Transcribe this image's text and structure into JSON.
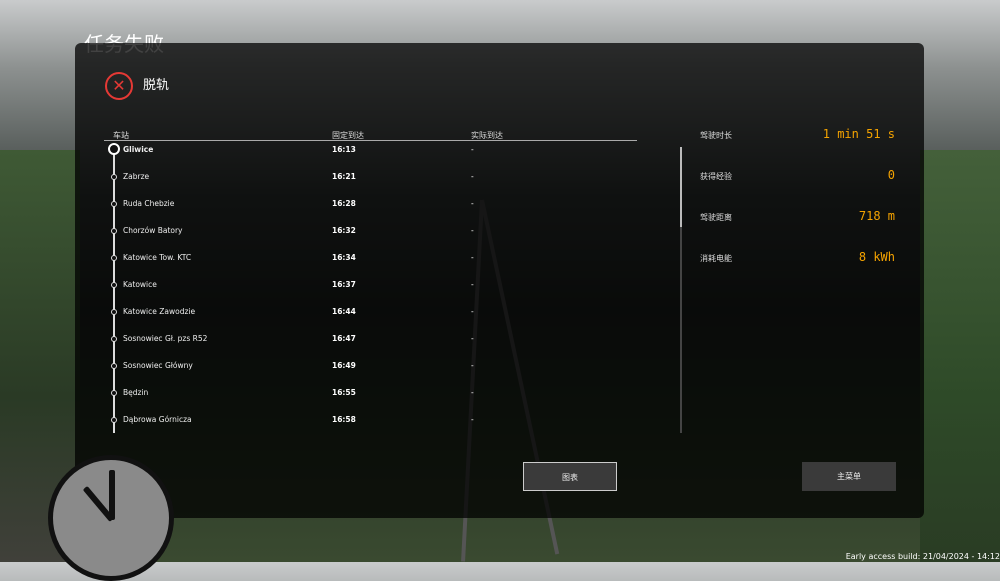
{
  "title": "任务失败",
  "failure": {
    "icon": "close-icon",
    "reason": "脱轨",
    "color": "#e53935"
  },
  "table": {
    "headers": {
      "station": "车站",
      "scheduled": "固定到达",
      "actual": "实际到达"
    },
    "rows": [
      {
        "station": "Gliwice",
        "scheduled": "16:13",
        "actual": "-"
      },
      {
        "station": "Zabrze",
        "scheduled": "16:21",
        "actual": "-"
      },
      {
        "station": "Ruda Chebzie",
        "scheduled": "16:28",
        "actual": "-"
      },
      {
        "station": "Chorzów Batory",
        "scheduled": "16:32",
        "actual": "-"
      },
      {
        "station": "Katowice Tow. KTC",
        "scheduled": "16:34",
        "actual": "-"
      },
      {
        "station": "Katowice",
        "scheduled": "16:37",
        "actual": "-"
      },
      {
        "station": "Katowice Zawodzie",
        "scheduled": "16:44",
        "actual": "-"
      },
      {
        "station": "Sosnowiec Gł. pzs R52",
        "scheduled": "16:47",
        "actual": "-"
      },
      {
        "station": "Sosnowiec Główny",
        "scheduled": "16:49",
        "actual": "-"
      },
      {
        "station": "Będzin",
        "scheduled": "16:55",
        "actual": "-"
      },
      {
        "station": "Dąbrowa Górnicza",
        "scheduled": "16:58",
        "actual": "-"
      }
    ]
  },
  "stats": [
    {
      "label": "驾驶时长",
      "value": "1 min 51 s"
    },
    {
      "label": "获得经验",
      "value": "0"
    },
    {
      "label": "驾驶距离",
      "value": "718 m"
    },
    {
      "label": "消耗电能",
      "value": "8 kWh"
    }
  ],
  "accent": "#f5a300",
  "buttons": {
    "chart": "图表",
    "main_menu": "主菜单"
  },
  "build": "Early access build: 21/04/2024 - 14:12"
}
